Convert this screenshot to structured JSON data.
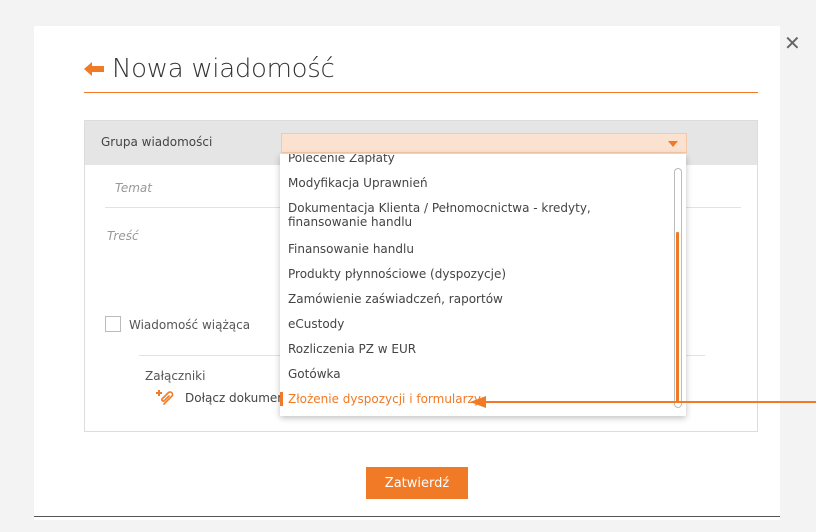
{
  "dialog": {
    "title": "Nowa wiadomość",
    "close_glyph": "✕"
  },
  "form": {
    "group_label": "Grupa wiadomości",
    "selected_group": "",
    "subject_placeholder": "Temat",
    "body_placeholder": "Treść",
    "binding_checkbox_label": "Wiadomość wiążąca",
    "binding_checked": false,
    "attachments_label": "Załączniki",
    "attach_link": "Dołącz dokument"
  },
  "dropdown": {
    "items": [
      "Polecenie Zapłaty",
      "Modyfikacja Uprawnień",
      "Dokumentacja Klienta / Pełnomocnictwa - kredyty, finansowanie handlu",
      "Finansowanie handlu",
      "Produkty płynnościowe (dyspozycje)",
      "Zamówienie zaświadczeń, raportów",
      "eCustody",
      "Rozliczenia PZ w EUR",
      "Gotówka",
      "Złożenie dyspozycji i formularzy"
    ],
    "highlighted": "Złożenie dyspozycji i formularzy"
  },
  "submit_label": "Zatwierdź",
  "colors": {
    "accent": "#f07a26",
    "select_bg": "#fbe1cf",
    "header_band": "#e5e5e5"
  },
  "icons": {
    "back": "back-arrow-icon",
    "close": "close-icon",
    "caret": "chevron-down-icon",
    "attach": "paperclip-plus-icon"
  }
}
